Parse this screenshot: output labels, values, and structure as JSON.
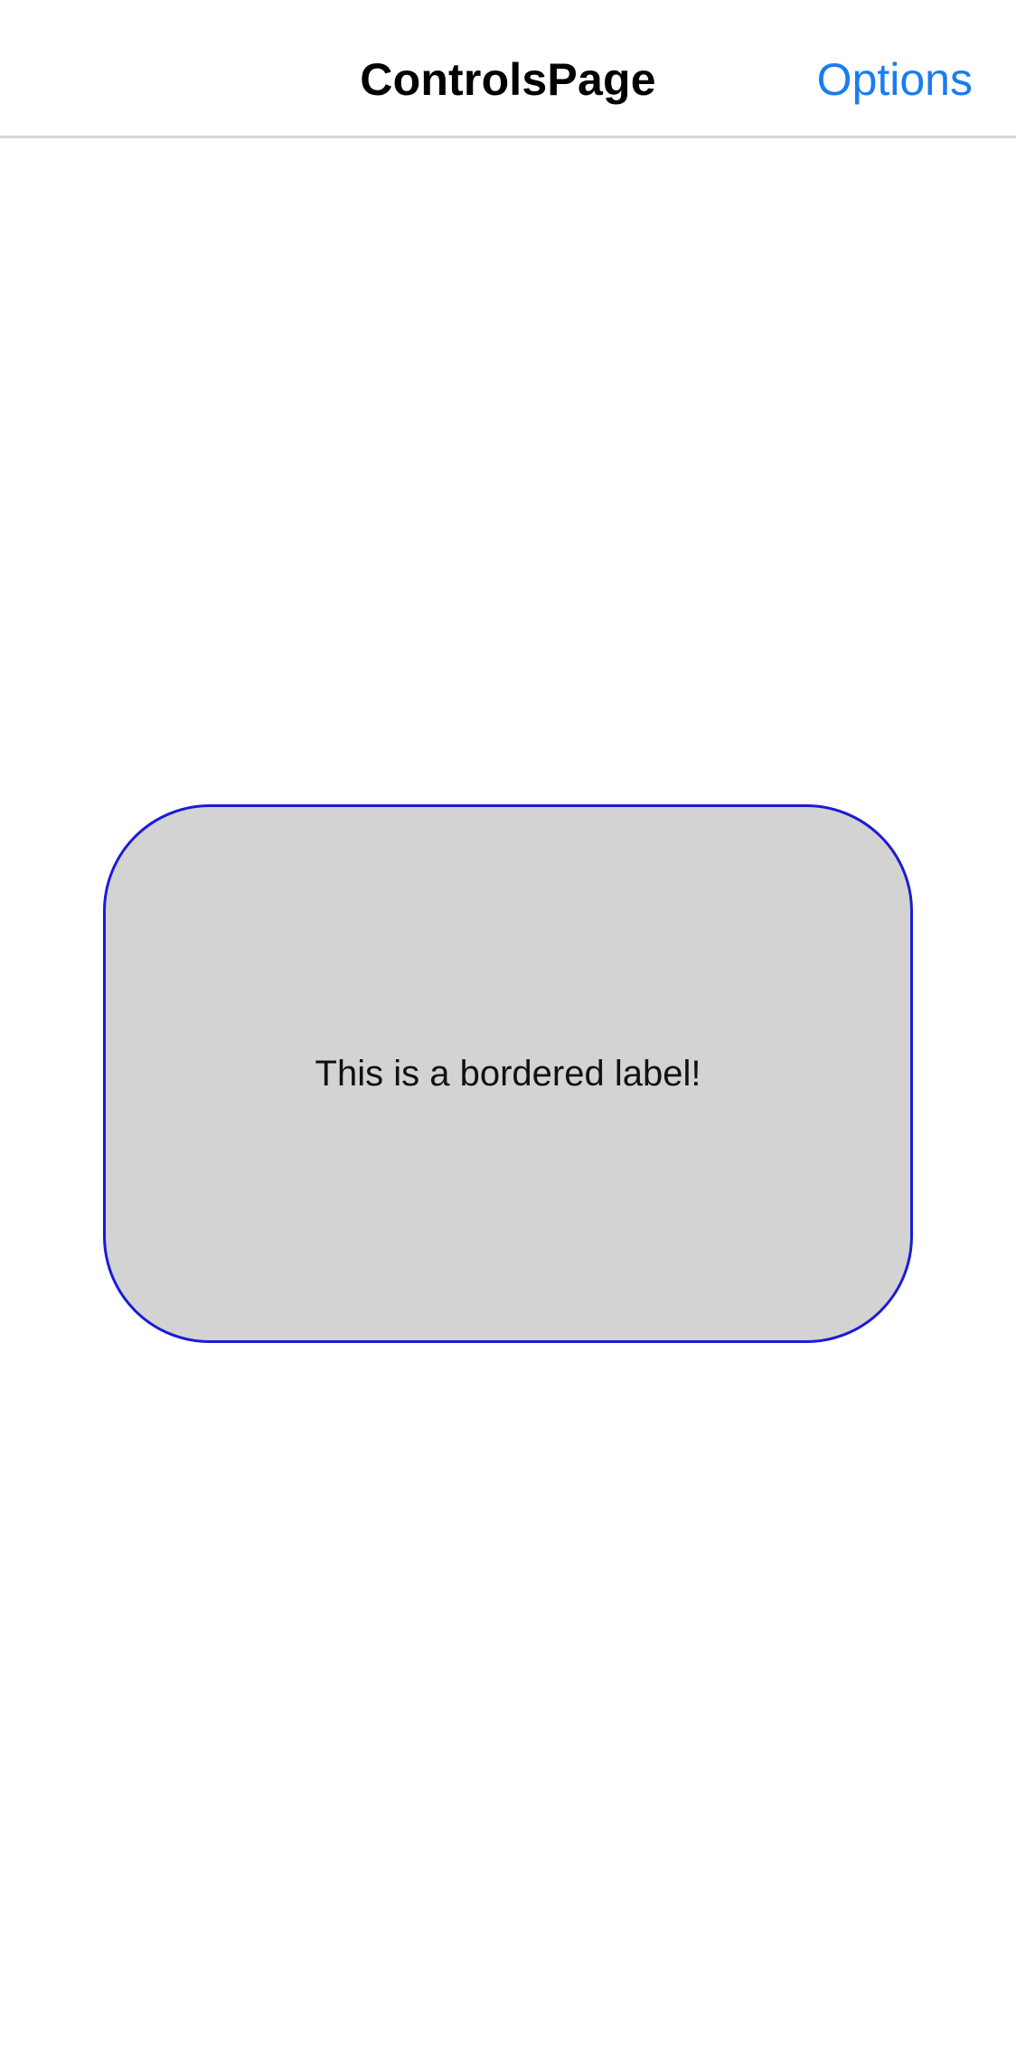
{
  "nav": {
    "title": "ControlsPage",
    "options_label": "Options"
  },
  "main": {
    "bordered_label_text": "This is a bordered label!"
  },
  "colors": {
    "accent": "#1a7cf2",
    "label_border": "#1b1bd6",
    "label_background": "#d3d3d3",
    "nav_divider": "#d6d6d8"
  }
}
